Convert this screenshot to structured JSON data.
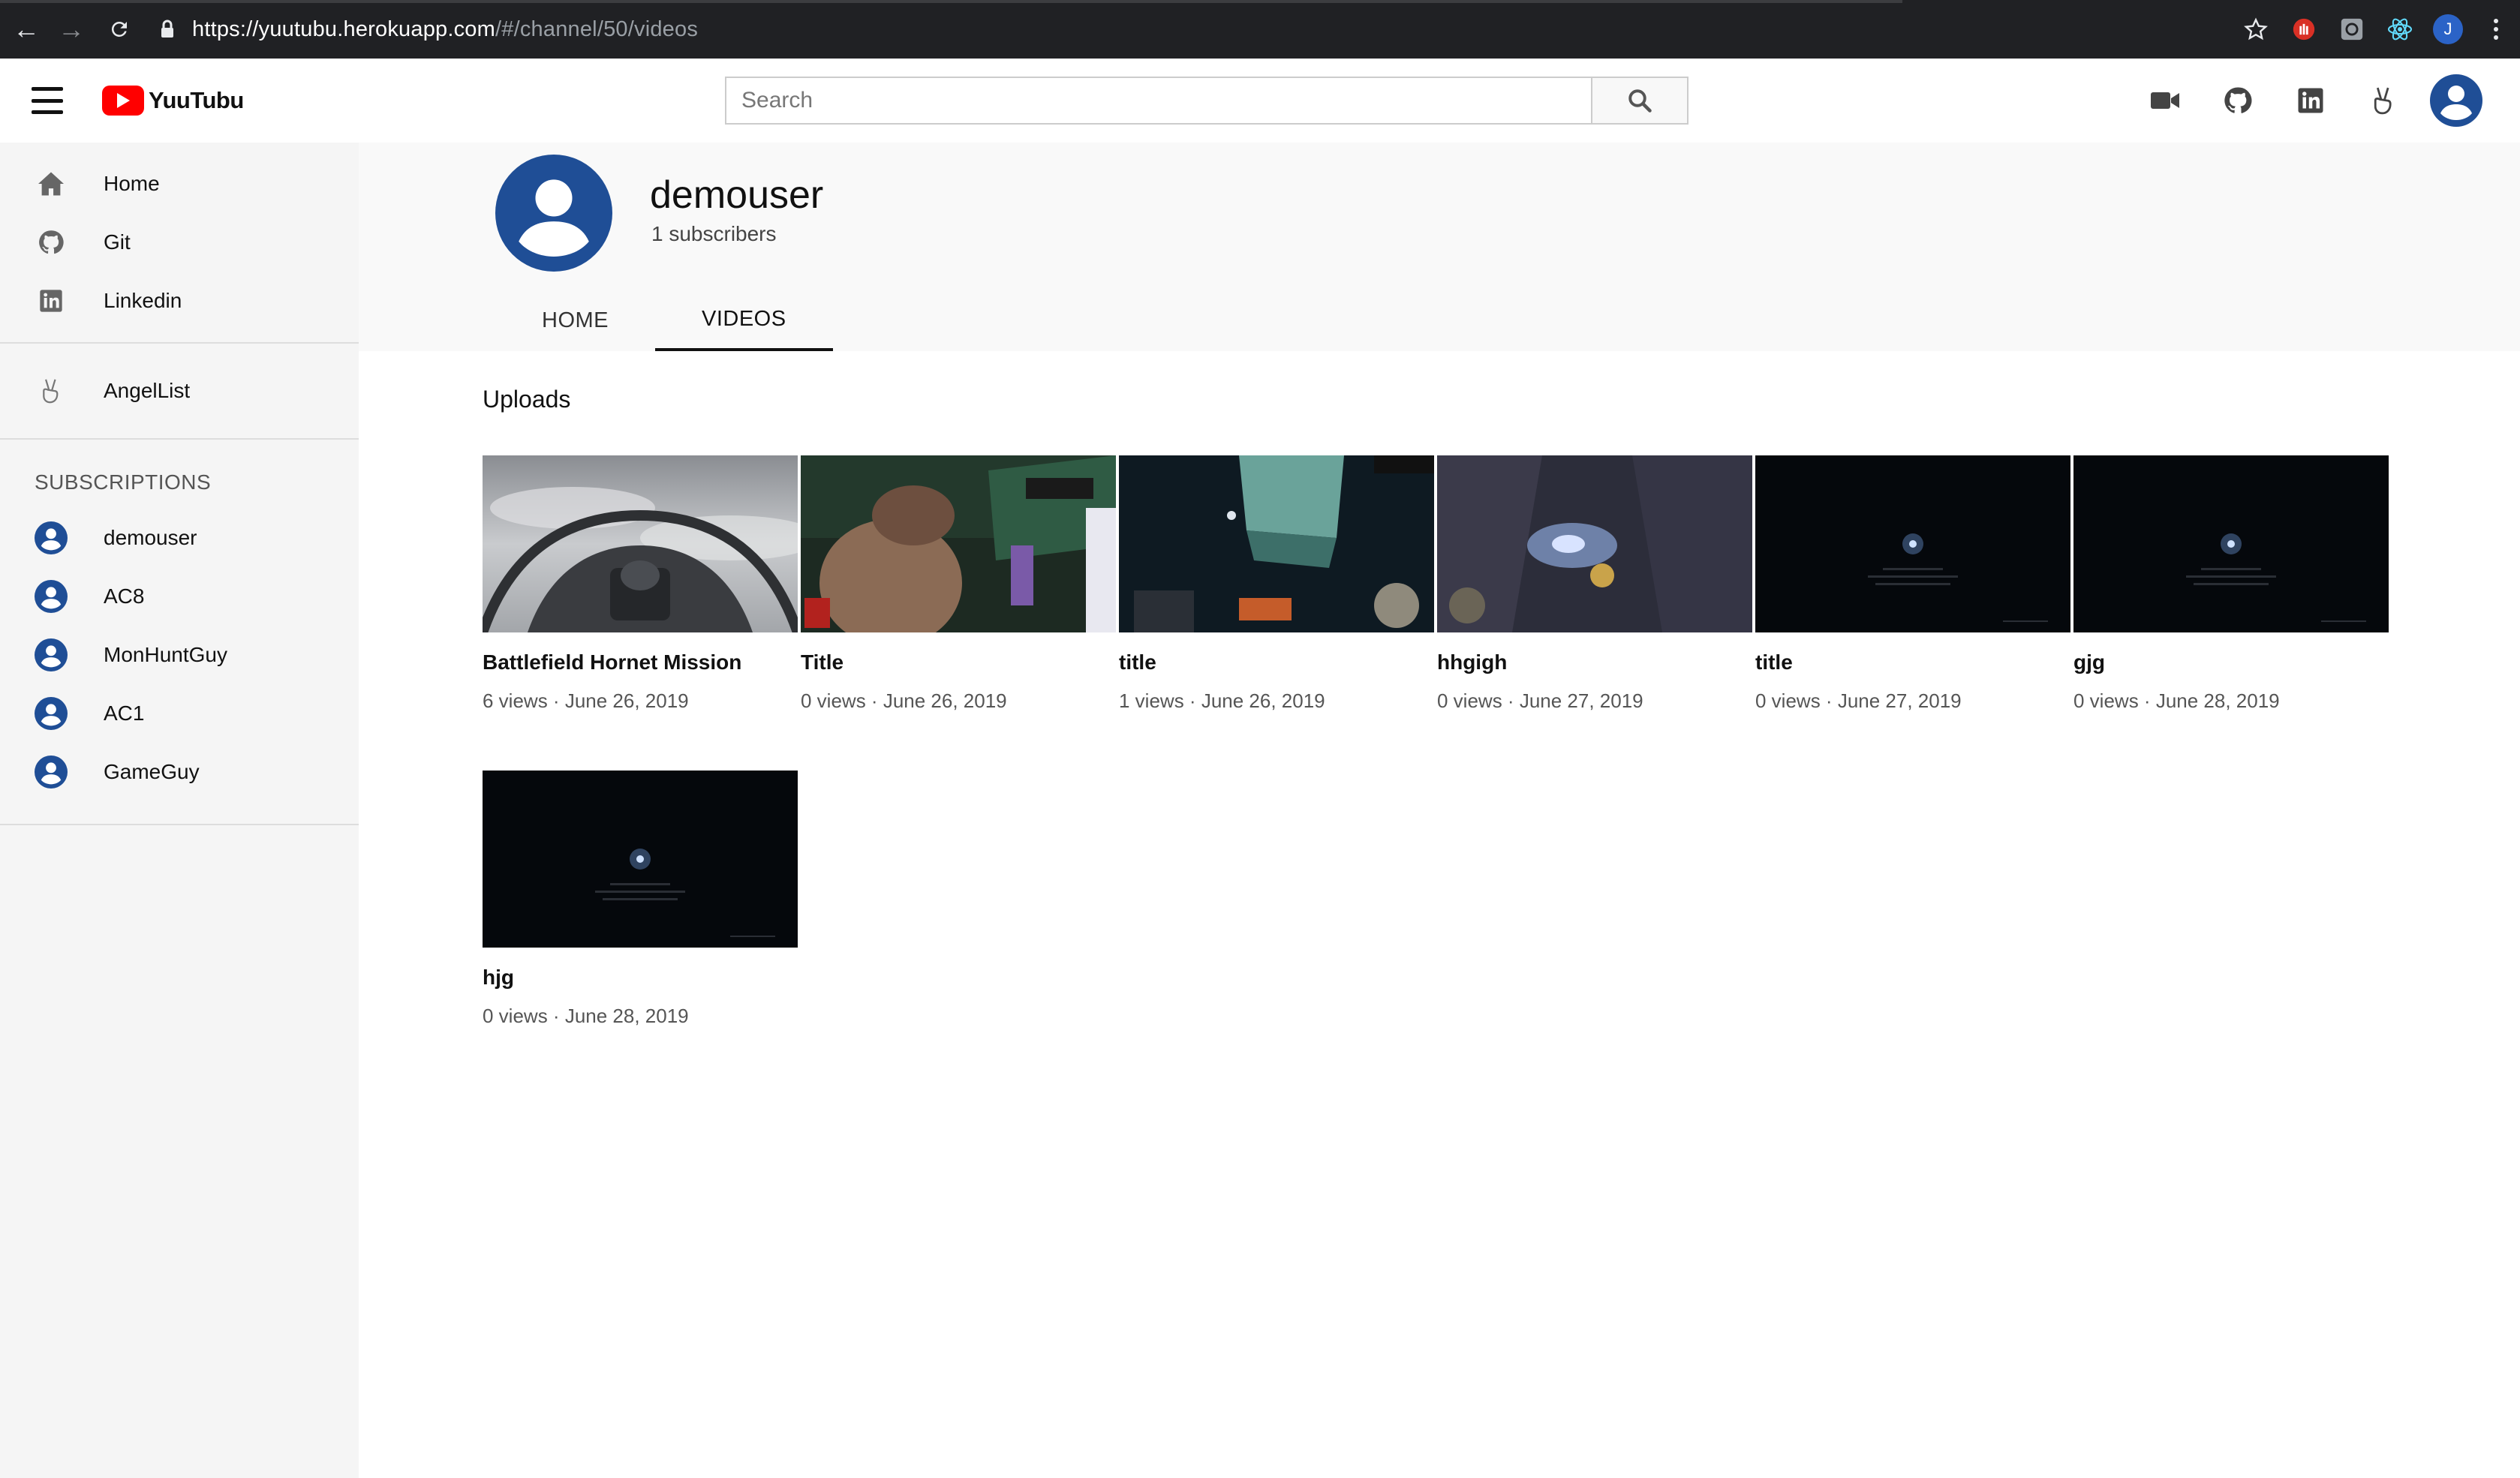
{
  "browser": {
    "url_host": "https://yuutubu.herokuapp.com",
    "url_path": "/#/channel/50/videos",
    "profile_initial": "J"
  },
  "header": {
    "logo_text": "YuuTubu",
    "search_placeholder": "Search"
  },
  "sidebar": {
    "main_items": [
      {
        "label": "Home",
        "icon": "home-icon"
      },
      {
        "label": "Git",
        "icon": "github-icon"
      },
      {
        "label": "Linkedin",
        "icon": "linkedin-icon"
      }
    ],
    "secondary_items": [
      {
        "label": "AngelList",
        "icon": "angellist-icon"
      }
    ],
    "subscriptions_heading": "SUBSCRIPTIONS",
    "subscriptions": [
      {
        "label": "demouser"
      },
      {
        "label": "AC8"
      },
      {
        "label": "MonHuntGuy"
      },
      {
        "label": "AC1"
      },
      {
        "label": "GameGuy"
      }
    ]
  },
  "channel": {
    "name": "demouser",
    "subscribers": "1 subscribers",
    "tabs": [
      {
        "label": "HOME",
        "active": false
      },
      {
        "label": "VIDEOS",
        "active": true
      }
    ]
  },
  "uploads": {
    "title": "Uploads",
    "videos": [
      {
        "title": "Battlefield Hornet Mission",
        "views": "6 views",
        "date": "June 26, 2019",
        "thumb": "cockpit"
      },
      {
        "title": "Title",
        "views": "0 views",
        "date": "June 26, 2019",
        "thumb": "vrchat"
      },
      {
        "title": "title",
        "views": "1 views",
        "date": "June 26, 2019",
        "thumb": "vrchat-dark"
      },
      {
        "title": "hhgigh",
        "views": "0 views",
        "date": "June 27, 2019",
        "thumb": "monster"
      },
      {
        "title": "title",
        "views": "0 views",
        "date": "June 27, 2019",
        "thumb": "black"
      },
      {
        "title": "gjg",
        "views": "0 views",
        "date": "June 28, 2019",
        "thumb": "black"
      },
      {
        "title": "hjg",
        "views": "0 views",
        "date": "June 28, 2019",
        "thumb": "black"
      }
    ]
  },
  "colors": {
    "brand_red": "#ff0000",
    "avatar_blue": "#1f4e96",
    "sidebar_bg": "#f5f5f5"
  }
}
